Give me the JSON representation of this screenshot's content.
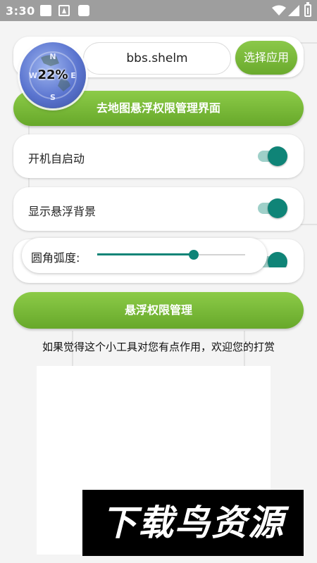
{
  "status_bar": {
    "time": "3:30"
  },
  "app_selector": {
    "value": "bbs.shelm",
    "select_label": "选择应用"
  },
  "map_button": {
    "label": "去地图悬浮权限管理界面"
  },
  "settings": {
    "autostart": {
      "label": "开机自启动",
      "enabled": true
    },
    "show_float_bg": {
      "label": "显示悬浮背景",
      "enabled": true
    },
    "corner_radius": {
      "label": "圆角弧度:",
      "value_fraction": 0.65,
      "enabled": true
    }
  },
  "float_permission_button": {
    "label": "悬浮权限管理"
  },
  "footer": {
    "text": "如果觉得这个小工具对您有点作用，欢迎您的打赏"
  },
  "overlay_bubble": {
    "percent": "22%",
    "icon": "compass-icon"
  },
  "watermark": {
    "text": "下载鸟资源"
  },
  "colors": {
    "accent_green": "#76b638",
    "switch_teal": "#0f8477",
    "status_bar": "#9e9e9e"
  }
}
